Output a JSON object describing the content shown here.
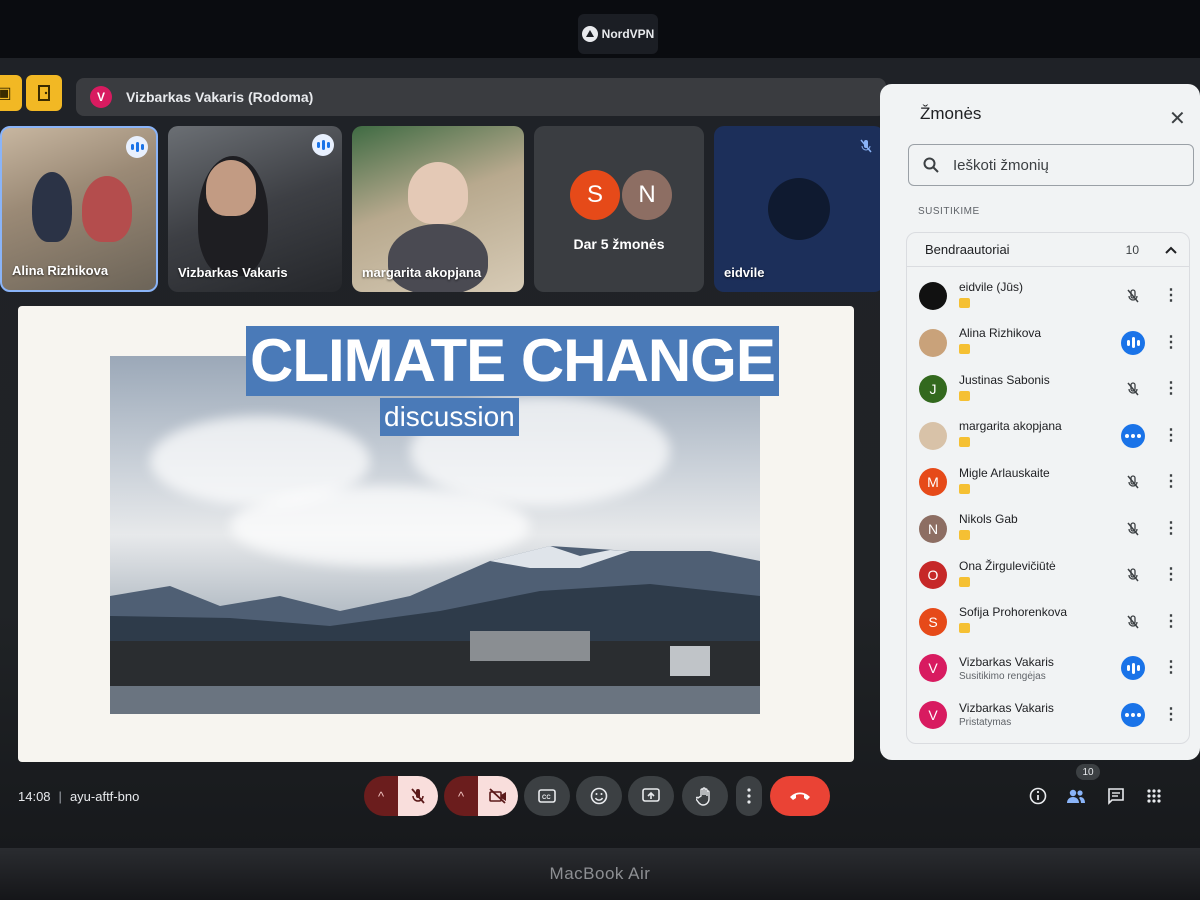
{
  "bezel": {
    "vpn_label": "NordVPN",
    "laptop_label": "MacBook Air"
  },
  "presenter_bar": {
    "avatar_letter": "V",
    "title": "Vizbarkas Vakaris (Rodoma)"
  },
  "tiles": [
    {
      "name": "Alina Rizhikova"
    },
    {
      "name": "Vizbarkas Vakaris"
    },
    {
      "name": "margarita akopjana"
    },
    {
      "name": "Dar 5 žmonės",
      "avatars": [
        "S",
        "N"
      ]
    },
    {
      "name": "eidvile"
    }
  ],
  "slide": {
    "title": "CLIMATE CHANGE",
    "subtitle": "discussion"
  },
  "people_panel": {
    "title": "Žmonės",
    "search_placeholder": "Ieškoti žmonių",
    "section_label": "SUSITIKIME",
    "group_label": "Bendraautoriai",
    "group_count": "10",
    "participants": [
      {
        "name": "eidvile (Jūs)",
        "letter": "",
        "color": "#111111",
        "status": "muted"
      },
      {
        "name": "Alina Rizhikova",
        "letter": "",
        "color": "#c9a27a",
        "status": "speaking"
      },
      {
        "name": "Justinas Sabonis",
        "letter": "J",
        "color": "#33691e",
        "status": "muted"
      },
      {
        "name": "margarita akopjana",
        "letter": "",
        "color": "#d8c2a8",
        "status": "active"
      },
      {
        "name": "Migle Arlauskaite",
        "letter": "M",
        "color": "#e64a19",
        "status": "muted"
      },
      {
        "name": "Nikols Gab",
        "letter": "N",
        "color": "#8d6e63",
        "status": "muted"
      },
      {
        "name": "Ona Žirgulevičiūtė",
        "letter": "O",
        "color": "#c62828",
        "status": "muted"
      },
      {
        "name": "Sofija Prohorenkova",
        "letter": "S",
        "color": "#e64a19",
        "status": "muted"
      },
      {
        "name": "Vizbarkas Vakaris",
        "letter": "V",
        "color": "#d81b60",
        "status": "speaking",
        "subtitle": "Susitikimo rengėjas"
      },
      {
        "name": "Vizbarkas Vakaris",
        "letter": "V",
        "color": "#d81b60",
        "status": "active",
        "subtitle": "Pristatymas"
      }
    ]
  },
  "bottom_bar": {
    "time": "14:08",
    "meeting_code": "ayu-aftf-bno",
    "people_count": "10"
  },
  "colors": {
    "accent_blue": "#1a73e8",
    "end_call_red": "#ea4335",
    "highlight_yellow": "#f2b824"
  }
}
